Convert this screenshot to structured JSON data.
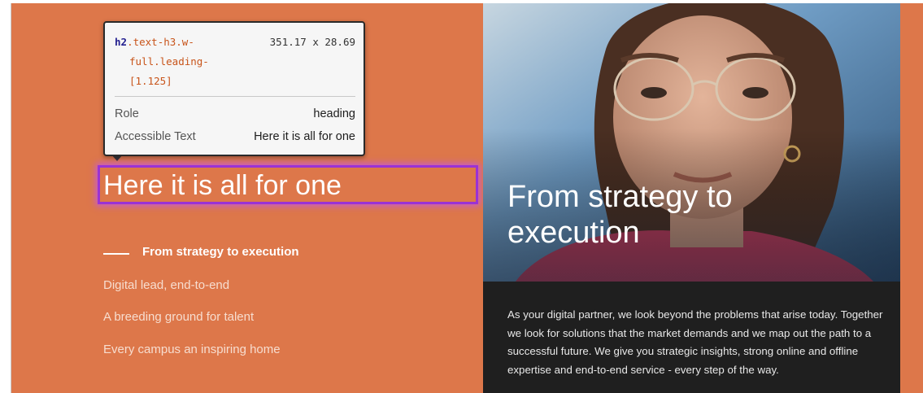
{
  "inspector": {
    "tag": "h2",
    "class_line1": ".text-h3.w-",
    "class_line2": "full.leading-",
    "class_line3": "[1.125]",
    "dimensions": "351.17 x 28.69",
    "role_label": "Role",
    "role_value": "heading",
    "accessible_label": "Accessible Text",
    "accessible_value": "Here it is all for one"
  },
  "main": {
    "heading": "Here it is all for one",
    "nav": {
      "active": "From strategy to execution",
      "items": [
        "Digital lead, end-to-end",
        "A breeding ground for talent",
        "Every campus an inspiring home"
      ]
    }
  },
  "feature": {
    "title": "From strategy to execution",
    "body": "As your digital partner, we look beyond the problems that arise today. Together we look for solutions that the market demands and we map out the path to a successful future. We give you strategic insights, strong online and offline expertise and end-to-end service - every step of the way."
  },
  "colors": {
    "page_bg": "#dd774a",
    "highlight": "#9a32d4",
    "panel_bg": "#1f1f1f"
  }
}
